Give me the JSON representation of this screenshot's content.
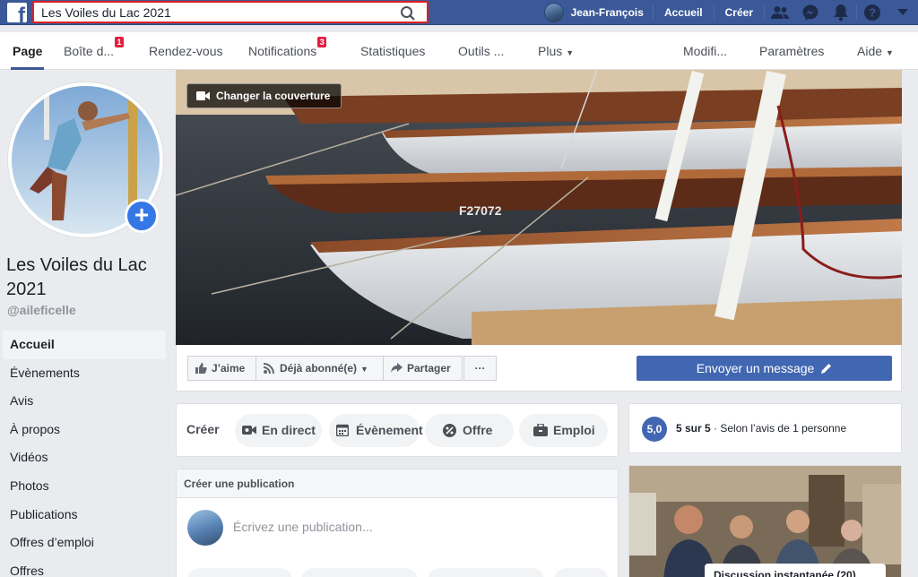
{
  "topbar": {
    "search_value": "Les Voiles du Lac 2021",
    "user_name": "Jean-François",
    "links": [
      "Accueil",
      "Créer"
    ],
    "icons": [
      "friends-icon",
      "messenger-icon",
      "bell-icon",
      "help-icon",
      "dropdown-icon"
    ]
  },
  "pagenav": {
    "tabs": [
      {
        "label": "Page",
        "badge": ""
      },
      {
        "label": "Boîte d...",
        "badge": "1"
      },
      {
        "label": "Rendez-vous",
        "badge": ""
      },
      {
        "label": "Notifications",
        "badge": "3"
      },
      {
        "label": "Statistiques",
        "badge": ""
      },
      {
        "label": "Outils ...",
        "badge": ""
      },
      {
        "label": "Plus",
        "badge": ""
      },
      {
        "label": "Modifi...",
        "badge": ""
      },
      {
        "label": "Paramètres",
        "badge": ""
      },
      {
        "label": "Aide",
        "badge": ""
      }
    ]
  },
  "profile": {
    "name": "Les Voiles du Lac 2021",
    "handle": "@aileficelle"
  },
  "sidenav": [
    "Accueil",
    "Évènements",
    "Avis",
    "À propos",
    "Vidéos",
    "Photos",
    "Publications",
    "Offres d’emploi",
    "Offres"
  ],
  "cover": {
    "change_label": "Changer la couverture",
    "hull_number": "F27072"
  },
  "actions": {
    "like": "J’aime",
    "subscribed": "Déjà abonné(e)",
    "share": "Partager",
    "more": "···",
    "send_message": "Envoyer un message"
  },
  "create": {
    "label": "Créer",
    "live": "En direct",
    "event": "Évènement",
    "offer": "Offre",
    "job": "Emploi"
  },
  "rating": {
    "score": "5,0",
    "bold": "5 sur 5",
    "rest": " · Selon l’avis de 1 personne"
  },
  "publication": {
    "header": "Créer une publication",
    "placeholder": "Écrivez une publication..."
  },
  "photo_card": {
    "caption": "Discussion instantanée (20)"
  },
  "colors": {
    "fb_blue": "#3b5998",
    "button_blue": "#4267b2",
    "badge_red": "#e41e3f",
    "search_border": "#e02020"
  }
}
